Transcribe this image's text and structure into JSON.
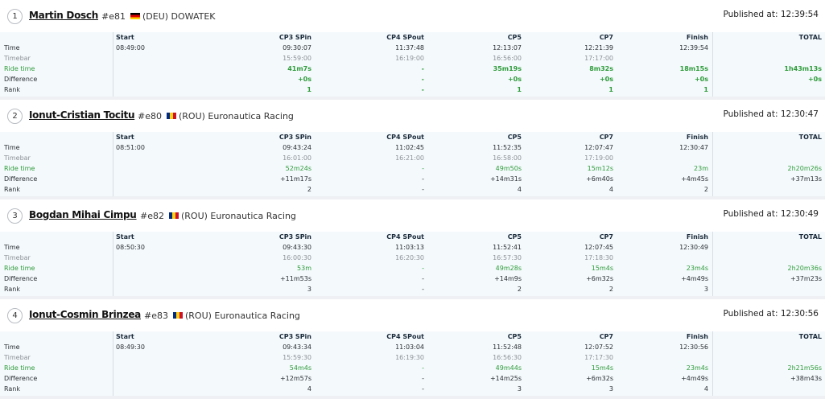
{
  "row_labels": {
    "time": "Time",
    "timebar": "Timebar",
    "ride": "Ride time",
    "diff": "Difference",
    "rank": "Rank"
  },
  "entries": [
    {
      "position": "1",
      "name": "Martin Dosch",
      "bib": "#e81",
      "country": "(DEU)",
      "team": "DOWATEK",
      "flag": "deu",
      "published_label": "Published at:",
      "published_time": "12:39:54",
      "leader": true,
      "columns": [
        {
          "header": "Start",
          "time": "08:49:00",
          "timebar": "",
          "ride": "",
          "diff": "",
          "rank": ""
        },
        {
          "header": "CP3 SPin",
          "time": "09:30:07",
          "timebar": "15:59:00",
          "ride": "41m7s",
          "diff": "+0s",
          "rank": "1"
        },
        {
          "header": "CP4 SPout",
          "time": "11:37:48",
          "timebar": "16:19:00",
          "ride": "-",
          "diff": "-",
          "rank": "-"
        },
        {
          "header": "CP5",
          "time": "12:13:07",
          "timebar": "16:56:00",
          "ride": "35m19s",
          "diff": "+0s",
          "rank": "1"
        },
        {
          "header": "CP7",
          "time": "12:21:39",
          "timebar": "17:17:00",
          "ride": "8m32s",
          "diff": "+0s",
          "rank": "1"
        },
        {
          "header": "Finish",
          "time": "12:39:54",
          "timebar": "",
          "ride": "18m15s",
          "diff": "+0s",
          "rank": "1"
        },
        {
          "header": "TOTAL",
          "time": "",
          "timebar": "",
          "ride": "1h43m13s",
          "diff": "+0s",
          "rank": ""
        }
      ]
    },
    {
      "position": "2",
      "name": "Ionut-Cristian Tocitu",
      "bib": "#e80",
      "country": "(ROU)",
      "team": "Euronautica Racing",
      "flag": "rou",
      "published_label": "Published at:",
      "published_time": "12:30:47",
      "leader": false,
      "columns": [
        {
          "header": "Start",
          "time": "08:51:00",
          "timebar": "",
          "ride": "",
          "diff": "",
          "rank": ""
        },
        {
          "header": "CP3 SPin",
          "time": "09:43:24",
          "timebar": "16:01:00",
          "ride": "52m24s",
          "diff": "+11m17s",
          "rank": "2"
        },
        {
          "header": "CP4 SPout",
          "time": "11:02:45",
          "timebar": "16:21:00",
          "ride": "-",
          "diff": "-",
          "rank": "-"
        },
        {
          "header": "CP5",
          "time": "11:52:35",
          "timebar": "16:58:00",
          "ride": "49m50s",
          "diff": "+14m31s",
          "rank": "4"
        },
        {
          "header": "CP7",
          "time": "12:07:47",
          "timebar": "17:19:00",
          "ride": "15m12s",
          "diff": "+6m40s",
          "rank": "4"
        },
        {
          "header": "Finish",
          "time": "12:30:47",
          "timebar": "",
          "ride": "23m",
          "diff": "+4m45s",
          "rank": "2"
        },
        {
          "header": "TOTAL",
          "time": "",
          "timebar": "",
          "ride": "2h20m26s",
          "diff": "+37m13s",
          "rank": ""
        }
      ]
    },
    {
      "position": "3",
      "name": "Bogdan Mihai Cimpu",
      "bib": "#e82",
      "country": "(ROU)",
      "team": "Euronautica Racing",
      "flag": "rou",
      "published_label": "Published at:",
      "published_time": "12:30:49",
      "leader": false,
      "columns": [
        {
          "header": "Start",
          "time": "08:50:30",
          "timebar": "",
          "ride": "",
          "diff": "",
          "rank": ""
        },
        {
          "header": "CP3 SPin",
          "time": "09:43:30",
          "timebar": "16:00:30",
          "ride": "53m",
          "diff": "+11m53s",
          "rank": "3"
        },
        {
          "header": "CP4 SPout",
          "time": "11:03:13",
          "timebar": "16:20:30",
          "ride": "-",
          "diff": "-",
          "rank": "-"
        },
        {
          "header": "CP5",
          "time": "11:52:41",
          "timebar": "16:57:30",
          "ride": "49m28s",
          "diff": "+14m9s",
          "rank": "2"
        },
        {
          "header": "CP7",
          "time": "12:07:45",
          "timebar": "17:18:30",
          "ride": "15m4s",
          "diff": "+6m32s",
          "rank": "2"
        },
        {
          "header": "Finish",
          "time": "12:30:49",
          "timebar": "",
          "ride": "23m4s",
          "diff": "+4m49s",
          "rank": "3"
        },
        {
          "header": "TOTAL",
          "time": "",
          "timebar": "",
          "ride": "2h20m36s",
          "diff": "+37m23s",
          "rank": ""
        }
      ]
    },
    {
      "position": "4",
      "name": "Ionut-Cosmin Brinzea",
      "bib": "#e83",
      "country": "(ROU)",
      "team": "Euronautica Racing",
      "flag": "rou",
      "published_label": "Published at:",
      "published_time": "12:30:56",
      "leader": false,
      "columns": [
        {
          "header": "Start",
          "time": "08:49:30",
          "timebar": "",
          "ride": "",
          "diff": "",
          "rank": ""
        },
        {
          "header": "CP3 SPin",
          "time": "09:43:34",
          "timebar": "15:59:30",
          "ride": "54m4s",
          "diff": "+12m57s",
          "rank": "4"
        },
        {
          "header": "CP4 SPout",
          "time": "11:03:04",
          "timebar": "16:19:30",
          "ride": "-",
          "diff": "-",
          "rank": "-"
        },
        {
          "header": "CP5",
          "time": "11:52:48",
          "timebar": "16:56:30",
          "ride": "49m44s",
          "diff": "+14m25s",
          "rank": "3"
        },
        {
          "header": "CP7",
          "time": "12:07:52",
          "timebar": "17:17:30",
          "ride": "15m4s",
          "diff": "+6m32s",
          "rank": "3"
        },
        {
          "header": "Finish",
          "time": "12:30:56",
          "timebar": "",
          "ride": "23m4s",
          "diff": "+4m49s",
          "rank": "4"
        },
        {
          "header": "TOTAL",
          "time": "",
          "timebar": "",
          "ride": "2h21m56s",
          "diff": "+38m43s",
          "rank": ""
        }
      ]
    }
  ],
  "colors": {
    "ride": "#2e9b3a",
    "timebar": "#8c9298",
    "grid_bg": "#f4f9fc",
    "page_bg": "#eef0f3"
  }
}
